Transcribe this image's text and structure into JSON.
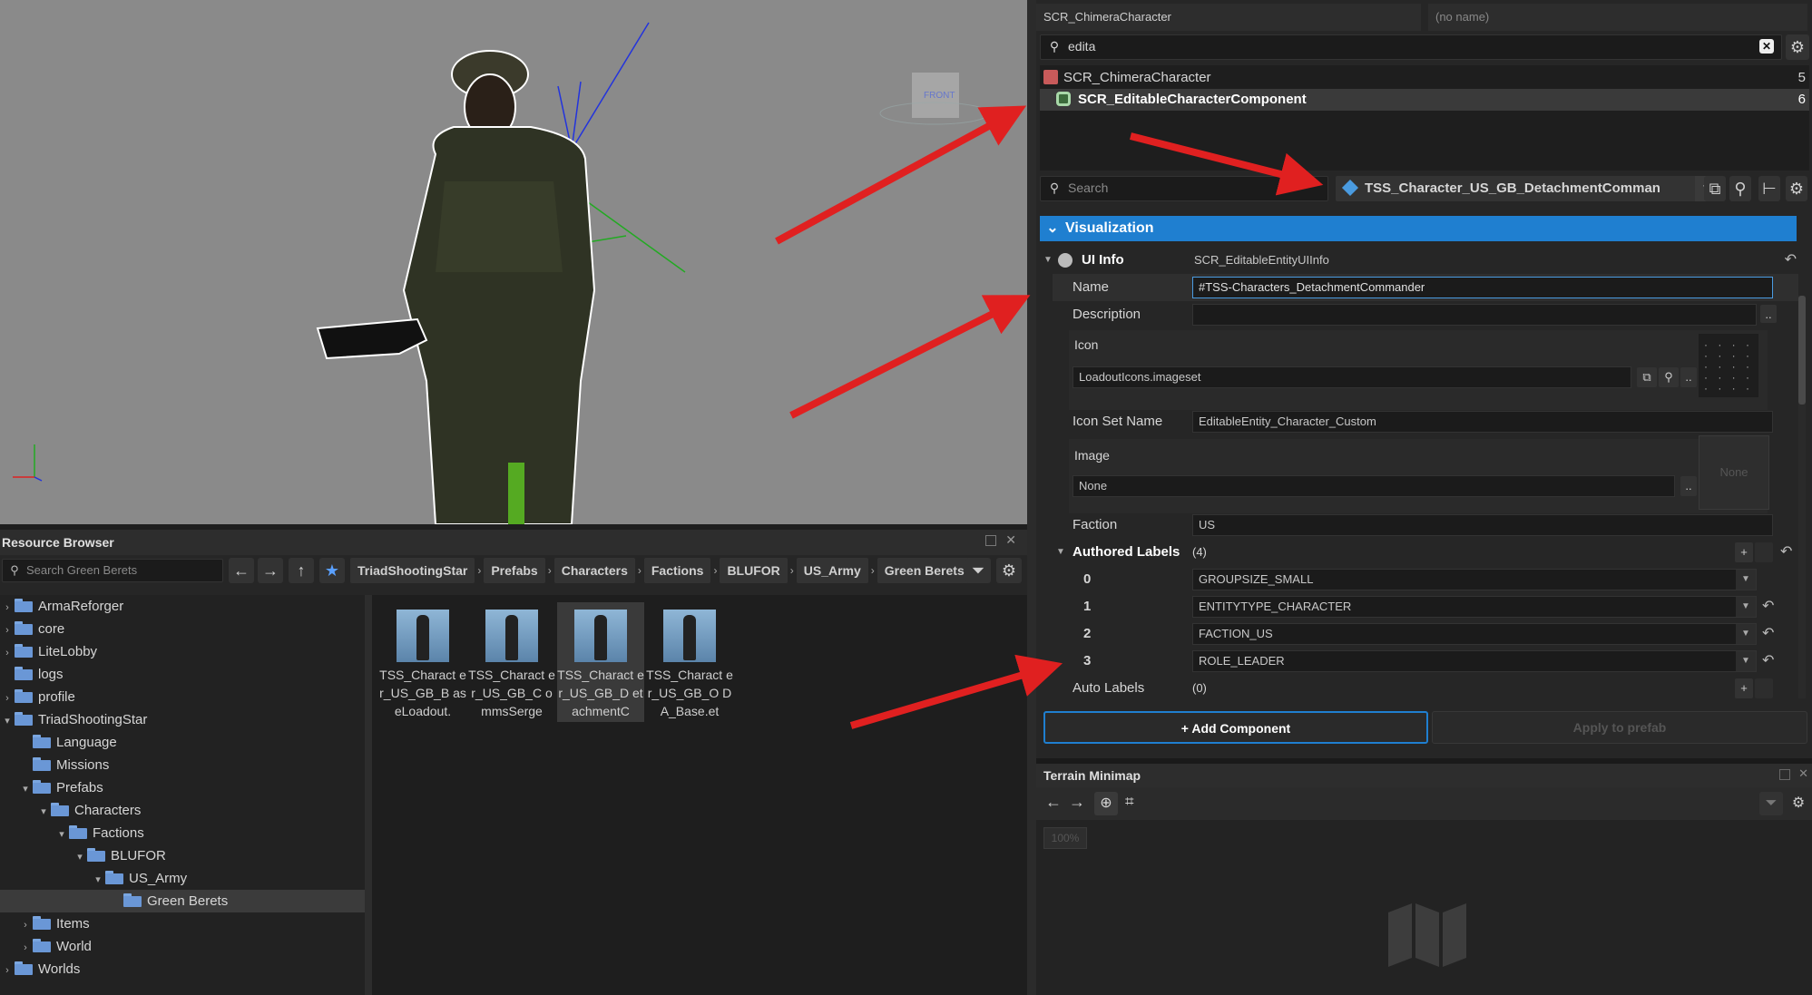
{
  "viewport": {
    "gizmo_label": "FRONT"
  },
  "resource_browser": {
    "title": "Resource Browser",
    "search_placeholder": "Search Green Berets",
    "breadcrumb": [
      "TriadShootingStar",
      "Prefabs",
      "Characters",
      "Factions",
      "BLUFOR",
      "US_Army",
      "Green Berets"
    ],
    "tree": [
      {
        "label": "ArmaReforger",
        "depth": 0,
        "arrow": "›",
        "locked": true
      },
      {
        "label": "core",
        "depth": 0,
        "arrow": "›",
        "locked": true
      },
      {
        "label": "LiteLobby",
        "depth": 0,
        "arrow": "›"
      },
      {
        "label": "logs",
        "depth": 0,
        "arrow": ""
      },
      {
        "label": "profile",
        "depth": 0,
        "arrow": "›"
      },
      {
        "label": "TriadShootingStar",
        "depth": 0,
        "arrow": "▾"
      },
      {
        "label": "Language",
        "depth": 1,
        "arrow": ""
      },
      {
        "label": "Missions",
        "depth": 1,
        "arrow": ""
      },
      {
        "label": "Prefabs",
        "depth": 1,
        "arrow": "▾"
      },
      {
        "label": "Characters",
        "depth": 2,
        "arrow": "▾"
      },
      {
        "label": "Factions",
        "depth": 3,
        "arrow": "▾"
      },
      {
        "label": "BLUFOR",
        "depth": 4,
        "arrow": "▾"
      },
      {
        "label": "US_Army",
        "depth": 5,
        "arrow": "▾"
      },
      {
        "label": "Green Berets",
        "depth": 6,
        "arrow": "",
        "selected": true
      },
      {
        "label": "Items",
        "depth": 1,
        "arrow": "›"
      },
      {
        "label": "World",
        "depth": 1,
        "arrow": "›"
      },
      {
        "label": "Worlds",
        "depth": 0,
        "arrow": "›"
      }
    ],
    "files": [
      {
        "name": "TSS_Charact er_US_GB_B aseLoadout.",
        "selected": false
      },
      {
        "name": "TSS_Charact er_US_GB_C ommsSerge",
        "selected": false
      },
      {
        "name": "TSS_Charact er_US_GB_D etachmentC",
        "selected": true
      },
      {
        "name": "TSS_Charact er_US_GB_O DA_Base.et",
        "selected": false
      }
    ]
  },
  "inspector": {
    "entity_class": "SCR_ChimeraCharacter",
    "entity_name_placeholder": "(no name)",
    "component_filter": "edita",
    "components": [
      {
        "label": "SCR_ChimeraCharacter",
        "count": "5"
      },
      {
        "label": "SCR_EditableCharacterComponent",
        "count": "6"
      }
    ],
    "prop_search_placeholder": "Search",
    "prefab_name": "TSS_Character_US_GB_DetachmentComman",
    "section": "Visualization",
    "ui_info": {
      "label": "UI Info",
      "value": "SCR_EditableEntityUIInfo"
    },
    "name": {
      "label": "Name",
      "value": "#TSS-Characters_DetachmentCommander"
    },
    "description": {
      "label": "Description",
      "value": ""
    },
    "icon": {
      "label": "Icon",
      "value": "LoadoutIcons.imageset"
    },
    "icon_set_name": {
      "label": "Icon Set Name",
      "value": "EditableEntity_Character_Custom"
    },
    "image": {
      "label": "Image",
      "value": "None",
      "preview": "None"
    },
    "faction": {
      "label": "Faction",
      "value": "US"
    },
    "authored_labels": {
      "label": "Authored Labels",
      "count": "(4)",
      "items": [
        {
          "index": "0",
          "value": "GROUPSIZE_SMALL"
        },
        {
          "index": "1",
          "value": "ENTITYTYPE_CHARACTER"
        },
        {
          "index": "2",
          "value": "FACTION_US"
        },
        {
          "index": "3",
          "value": "ROLE_LEADER"
        }
      ]
    },
    "auto_labels": {
      "label": "Auto Labels",
      "count": "(0)"
    },
    "add_component": "+ Add Component",
    "apply_to_prefab": "Apply to prefab"
  },
  "minimap": {
    "title": "Terrain Minimap",
    "zoom": "100%"
  },
  "colors": {
    "accent": "#1f7fd0",
    "annotation": "#e02020"
  }
}
